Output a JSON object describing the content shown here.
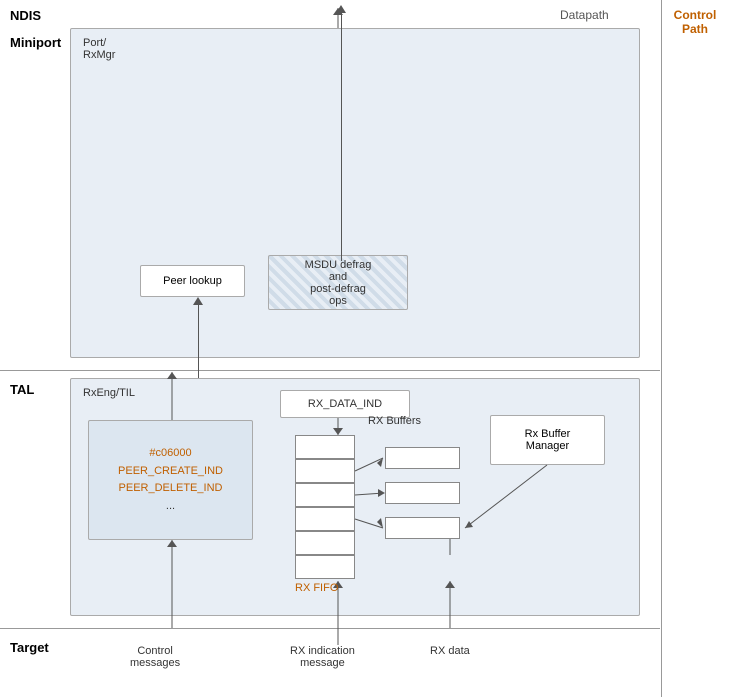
{
  "header": {
    "ndis_label": "NDIS",
    "datapath_label": "Datapath",
    "control_path_label": "Control Path"
  },
  "sections": {
    "miniport": "Miniport",
    "tal": "TAL",
    "target": "Target"
  },
  "boxes": {
    "port_rxmgr": "Port/\nRxMgr",
    "peer_lookup": "Peer lookup",
    "msdu_defrag": "MSDU defrag\nand\npost-defrag ops",
    "rxeng_til": "RxEng/TIL",
    "rx_data_ind": "RX_DATA_IND",
    "peer_create": "PEER_CREATE_IND\nPEER_DELETE_IND\n...",
    "rx_buffers_label": "RX Buffers",
    "rx_buffer_manager": "Rx Buffer\nManager",
    "rx_fifo_label": "RX FIFO"
  },
  "bottom_labels": {
    "control_messages": "Control\nmessages",
    "rx_indication": "RX indication\nmessage",
    "rx_data": "RX data"
  },
  "colors": {
    "accent_orange": "#c06000",
    "accent_blue": "#1f4e79",
    "box_bg": "#e8eef5",
    "inner_bg": "#dce6f0",
    "border": "#aaa",
    "line": "#555"
  }
}
